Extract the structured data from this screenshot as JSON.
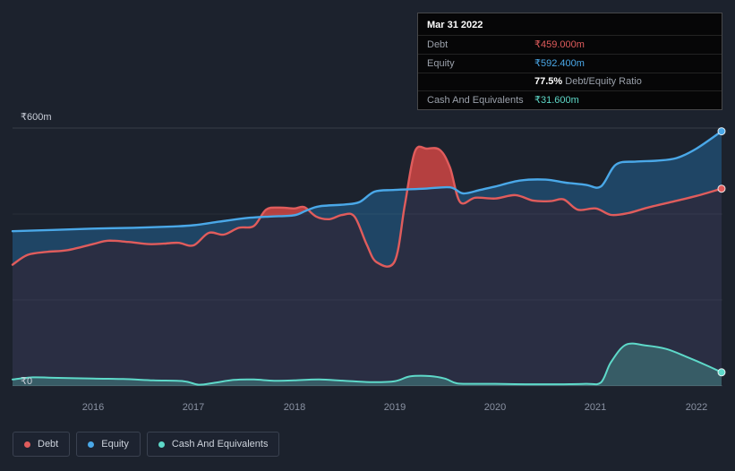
{
  "colors": {
    "background": "#1c222d",
    "debt": "#e05c5c",
    "equity": "#4aa8e8",
    "cash": "#5ed9c9",
    "debt_fill": "#b54040",
    "equity_fill": "#1f4565",
    "base_fill": "#2a2e43",
    "cash_fill": "rgba(94,217,201,0.27)",
    "grid_major": "rgba(255,255,255,0.13)",
    "grid_minor": "rgba(255,255,255,0.05)",
    "axis_text": "#8a92a2",
    "y_axis_text": "#c9ced8"
  },
  "y_axis": {
    "top": "₹600m",
    "bottom": "₹0"
  },
  "x_axis": {
    "labels": [
      "2016",
      "2017",
      "2018",
      "2019",
      "2020",
      "2021",
      "2022"
    ]
  },
  "tooltip": {
    "title": "Mar 31 2022",
    "rows": [
      {
        "label": "Debt",
        "value": "₹459.000m",
        "color": "debt"
      },
      {
        "label": "Equity",
        "value": "₹592.400m",
        "color": "equity"
      },
      {
        "label": "",
        "value_strong": "77.5%",
        "value_rest": "Debt/Equity Ratio"
      },
      {
        "label": "Cash And Equivalents",
        "value": "₹31.600m",
        "color": "cash"
      }
    ]
  },
  "legend": {
    "items": [
      {
        "label": "Debt",
        "color": "debt"
      },
      {
        "label": "Equity",
        "color": "equity"
      },
      {
        "label": "Cash And Equivalents",
        "color": "cash"
      }
    ]
  },
  "chart_data": {
    "type": "area",
    "x_unit": "year",
    "xlim": [
      2015.2,
      2022.25
    ],
    "ylim": [
      0,
      600
    ],
    "x_ticks": [
      2016,
      2017,
      2018,
      2019,
      2020,
      2021,
      2022
    ],
    "y_grid": [
      0,
      200,
      400,
      600
    ],
    "y_tick_labels": {
      "0": "₹0",
      "600": "₹600m"
    },
    "legend_position": "bottom-left",
    "series": [
      {
        "name": "Debt",
        "key": "debt",
        "unit": "₹m",
        "points": [
          [
            2015.2,
            282
          ],
          [
            2015.35,
            305
          ],
          [
            2015.55,
            312
          ],
          [
            2015.75,
            316
          ],
          [
            2016.0,
            330
          ],
          [
            2016.15,
            338
          ],
          [
            2016.35,
            335
          ],
          [
            2016.55,
            330
          ],
          [
            2016.7,
            331
          ],
          [
            2016.85,
            333
          ],
          [
            2017.0,
            327
          ],
          [
            2017.15,
            356
          ],
          [
            2017.3,
            352
          ],
          [
            2017.45,
            368
          ],
          [
            2017.6,
            372
          ],
          [
            2017.72,
            410
          ],
          [
            2017.85,
            415
          ],
          [
            2018.0,
            413
          ],
          [
            2018.1,
            416
          ],
          [
            2018.22,
            394
          ],
          [
            2018.35,
            388
          ],
          [
            2018.48,
            398
          ],
          [
            2018.6,
            394
          ],
          [
            2018.72,
            330
          ],
          [
            2018.82,
            288
          ],
          [
            2019.0,
            290
          ],
          [
            2019.1,
            420
          ],
          [
            2019.2,
            545
          ],
          [
            2019.32,
            552
          ],
          [
            2019.45,
            549
          ],
          [
            2019.55,
            508
          ],
          [
            2019.65,
            428
          ],
          [
            2019.8,
            438
          ],
          [
            2020.0,
            436
          ],
          [
            2020.2,
            444
          ],
          [
            2020.38,
            431
          ],
          [
            2020.55,
            430
          ],
          [
            2020.68,
            434
          ],
          [
            2020.82,
            410
          ],
          [
            2021.0,
            413
          ],
          [
            2021.15,
            398
          ],
          [
            2021.32,
            402
          ],
          [
            2021.5,
            414
          ],
          [
            2021.75,
            428
          ],
          [
            2022.0,
            442
          ],
          [
            2022.25,
            459
          ]
        ]
      },
      {
        "name": "Equity",
        "key": "equity",
        "unit": "₹m",
        "points": [
          [
            2015.2,
            360
          ],
          [
            2015.6,
            363
          ],
          [
            2016.0,
            366
          ],
          [
            2016.4,
            368
          ],
          [
            2016.8,
            371
          ],
          [
            2017.0,
            374
          ],
          [
            2017.25,
            382
          ],
          [
            2017.5,
            390
          ],
          [
            2017.75,
            394
          ],
          [
            2018.0,
            397
          ],
          [
            2018.12,
            408
          ],
          [
            2018.25,
            418
          ],
          [
            2018.5,
            422
          ],
          [
            2018.65,
            428
          ],
          [
            2018.8,
            452
          ],
          [
            2019.0,
            456
          ],
          [
            2019.3,
            459
          ],
          [
            2019.55,
            462
          ],
          [
            2019.68,
            448
          ],
          [
            2019.85,
            456
          ],
          [
            2020.0,
            464
          ],
          [
            2020.25,
            478
          ],
          [
            2020.5,
            480
          ],
          [
            2020.7,
            473
          ],
          [
            2020.9,
            468
          ],
          [
            2021.05,
            464
          ],
          [
            2021.2,
            515
          ],
          [
            2021.4,
            522
          ],
          [
            2021.6,
            524
          ],
          [
            2021.8,
            530
          ],
          [
            2022.0,
            552
          ],
          [
            2022.25,
            592.4
          ]
        ]
      },
      {
        "name": "Cash And Equivalents",
        "key": "cash",
        "unit": "₹m",
        "points": [
          [
            2015.2,
            15
          ],
          [
            2015.4,
            20
          ],
          [
            2015.6,
            19
          ],
          [
            2016.0,
            17
          ],
          [
            2016.3,
            16
          ],
          [
            2016.6,
            13
          ],
          [
            2016.9,
            11
          ],
          [
            2017.05,
            3
          ],
          [
            2017.2,
            7
          ],
          [
            2017.4,
            14
          ],
          [
            2017.6,
            15
          ],
          [
            2017.8,
            12
          ],
          [
            2018.0,
            13
          ],
          [
            2018.25,
            15
          ],
          [
            2018.5,
            12
          ],
          [
            2018.75,
            9
          ],
          [
            2019.0,
            11
          ],
          [
            2019.15,
            22
          ],
          [
            2019.35,
            23
          ],
          [
            2019.5,
            17
          ],
          [
            2019.62,
            6
          ],
          [
            2019.8,
            5
          ],
          [
            2020.0,
            5
          ],
          [
            2020.3,
            4
          ],
          [
            2020.6,
            4
          ],
          [
            2020.9,
            5
          ],
          [
            2021.05,
            8
          ],
          [
            2021.15,
            55
          ],
          [
            2021.3,
            96
          ],
          [
            2021.5,
            94
          ],
          [
            2021.7,
            86
          ],
          [
            2021.9,
            68
          ],
          [
            2022.1,
            48
          ],
          [
            2022.25,
            31.6
          ]
        ]
      }
    ]
  }
}
